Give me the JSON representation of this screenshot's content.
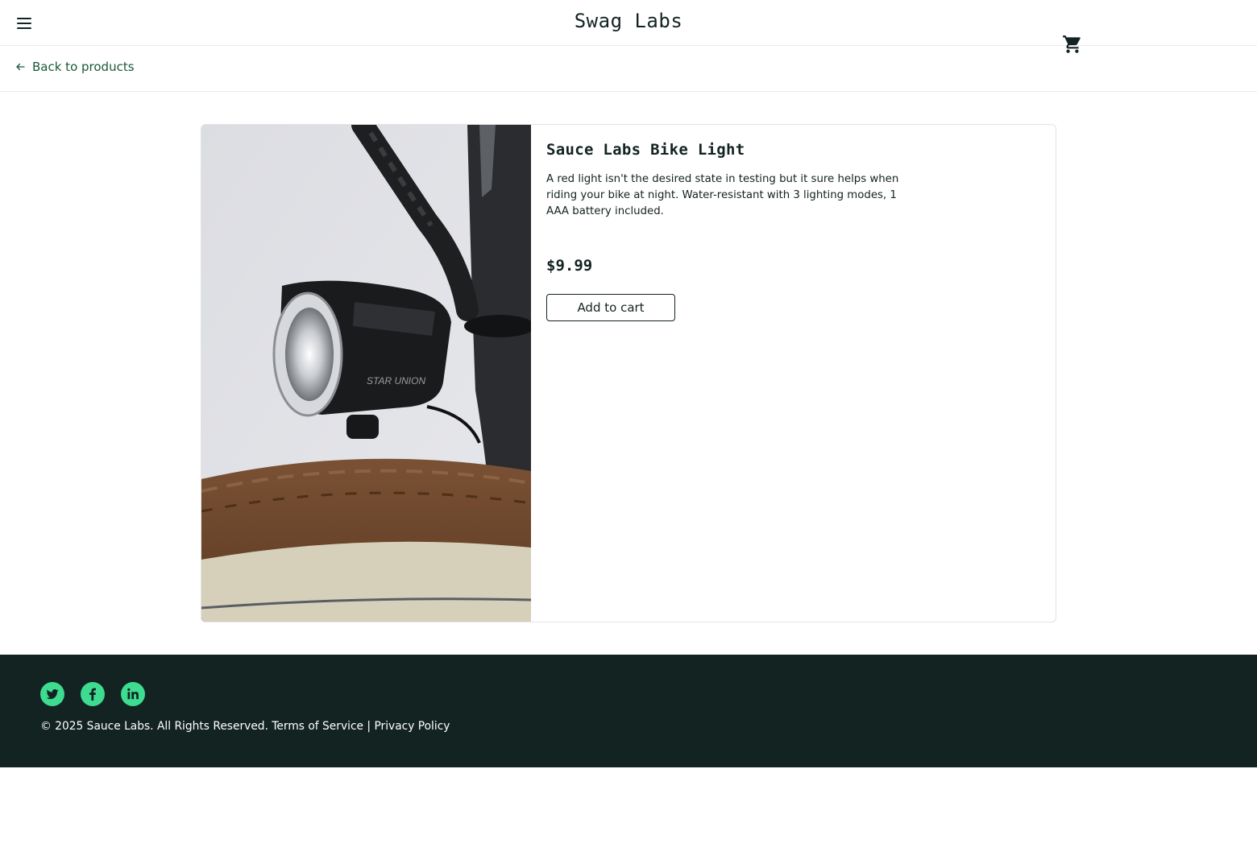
{
  "header": {
    "logo": "Swag Labs",
    "menu_icon": "hamburger-menu-icon",
    "cart_icon": "shopping-cart-icon"
  },
  "subheader": {
    "back_label": "Back to products",
    "back_icon": "arrow-left-icon"
  },
  "product": {
    "name": "Sauce Labs Bike Light",
    "description": "A red light isn't the desired state in testing but it sure helps when riding your bike at night. Water-resistant with 3 lighting modes, 1 AAA battery included.",
    "price": "$9.99",
    "add_to_cart_label": "Add to cart",
    "image_alt": "Sauce Labs Bike Light"
  },
  "footer": {
    "social": [
      {
        "name": "Twitter",
        "icon": "twitter-icon"
      },
      {
        "name": "Facebook",
        "icon": "facebook-icon"
      },
      {
        "name": "LinkedIn",
        "icon": "linkedin-icon"
      }
    ],
    "copy": "© 2025 Sauce Labs. All Rights Reserved. Terms of Service | Privacy Policy"
  },
  "colors": {
    "accent": "#18583a",
    "footer_bg": "#132322",
    "social_bg": "#3ddc91",
    "text": "#132322"
  }
}
